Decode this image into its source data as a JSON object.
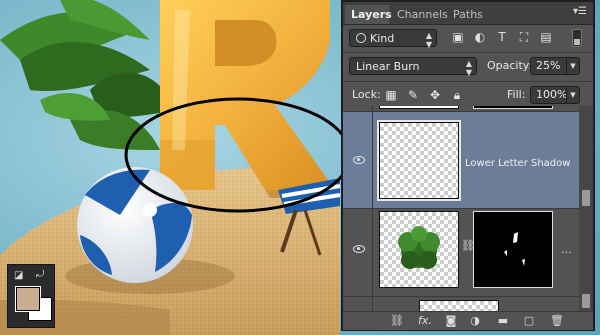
{
  "panel": {
    "tabs": [
      "Layers",
      "Channels",
      "Paths"
    ],
    "active_tab": "Layers",
    "menu_icon": "panel-menu-icon",
    "filter": {
      "kind_label": "Kind",
      "icons": [
        "image-filter-icon",
        "adjustment-filter-icon",
        "type-filter-icon",
        "shape-filter-icon",
        "smart-object-filter-icon"
      ]
    },
    "blend_mode": "Linear Burn",
    "opacity_label": "Opacity:",
    "opacity_value": "25%",
    "lock_label": "Lock:",
    "lock_icons": [
      "lock-transparent-pixels-icon",
      "lock-image-pixels-icon",
      "lock-position-icon",
      "lock-all-icon"
    ],
    "fill_label": "Fill:",
    "fill_value": "100%",
    "layers": [
      {
        "name": "",
        "visible": false,
        "selected": false
      },
      {
        "name": "Lower Letter Shadow",
        "visible": true,
        "selected": true
      },
      {
        "name": "",
        "visible": true,
        "selected": false,
        "has_mask": true,
        "more": "..."
      },
      {
        "name": "",
        "visible": false,
        "selected": false
      }
    ],
    "footer_icons": [
      "link-layers-icon",
      "fx-icon",
      "add-mask-icon",
      "adjustment-layer-icon",
      "new-group-icon",
      "new-layer-icon",
      "delete-layer-icon"
    ],
    "fx_label": "fx."
  },
  "tools": {
    "foreground_color": "#c9ae92",
    "background_color": "#ffffff"
  },
  "colors": {
    "sky": "#7fbcd0",
    "sand": "#d9b57a",
    "letter": "#f0b440",
    "ball_blue": "#1f5fb0",
    "selection_bg": "#6b7d98"
  }
}
